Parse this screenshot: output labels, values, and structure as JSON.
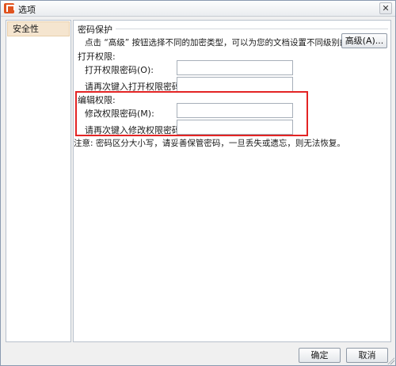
{
  "window": {
    "title": "选项",
    "close_symbol": "✕",
    "icon": "wps-presentation-icon"
  },
  "sidebar": {
    "items": [
      {
        "label": "安全性",
        "selected": true
      }
    ]
  },
  "password_protection": {
    "heading": "密码保护",
    "description": "点击 “高级” 按钮选择不同的加密类型，可以为您的文档设置不同级别的加密保护。",
    "advanced_button": "高级(A)..."
  },
  "open_permission": {
    "heading": "打开权限:",
    "password_label": "打开权限密码(O):",
    "password_value": "",
    "confirm_label": "请再次键入打开权限密码(P):",
    "confirm_value": ""
  },
  "edit_permission": {
    "heading": "编辑权限:",
    "password_label": "修改权限密码(M):",
    "password_value": "",
    "confirm_label": "请再次键入修改权限密码(R):",
    "confirm_value": ""
  },
  "note": "注意: 密码区分大小写，请妥善保管密码，一旦丢失或遗忘，则无法恢复。",
  "footer": {
    "ok_label": "确定",
    "cancel_label": "取消"
  },
  "colors": {
    "highlight": "#e32424",
    "selected_item_bg": "#f5e5cf",
    "app_icon": "#e0531f"
  }
}
